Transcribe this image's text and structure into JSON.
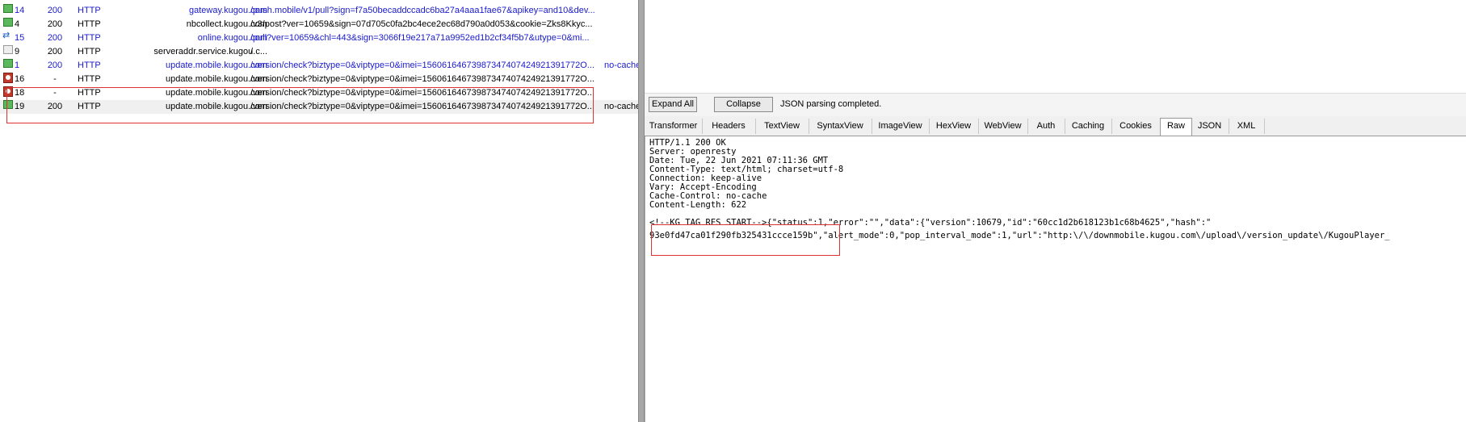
{
  "sessions": [
    {
      "icon": "green-arrow",
      "num": "14",
      "result": "200",
      "protocol": "HTTP",
      "host": "gateway.kugou.com",
      "url": "/push.mobile/v1/pull?sign=f7a50becaddccadc6ba27a4aaa1fae67&apikey=and10&dev...",
      "cache": "",
      "color": "blue",
      "selected": false
    },
    {
      "icon": "green-arrow",
      "num": "4",
      "result": "200",
      "protocol": "HTTP",
      "host": "nbcollect.kugou.com",
      "url": "/v3/post?ver=10659&sign=07d705c0fa2bc4ece2ec68d790a0d053&cookie=Zks8Kkyc...",
      "cache": "",
      "color": "black",
      "selected": false
    },
    {
      "icon": "arrows",
      "num": "15",
      "result": "200",
      "protocol": "HTTP",
      "host": "online.kugou.com",
      "url": "/pull?ver=10659&chl=443&sign=3066f19e217a71a9952ed1b2cf34f5b7&utype=0&mi...",
      "cache": "",
      "color": "blue",
      "selected": false
    },
    {
      "icon": "grey",
      "num": "9",
      "result": "200",
      "protocol": "HTTP",
      "host": "serveraddr.service.kugou.c...",
      "url": "/",
      "cache": "",
      "color": "black",
      "selected": false
    },
    {
      "icon": "green-arrow",
      "num": "1",
      "result": "200",
      "protocol": "HTTP",
      "host": "update.mobile.kugou.com",
      "url": "/version/check?biztype=0&viptype=0&imei=15606164673987347407424921391772O...",
      "cache": "no-cache",
      "color": "blue",
      "selected": false
    },
    {
      "icon": "red-stop",
      "num": "16",
      "result": "-",
      "protocol": "HTTP",
      "host": "update.mobile.kugou.com",
      "url": "/version/check?biztype=0&viptype=0&imei=15606164673987347407424921391772O...",
      "cache": "",
      "color": "black",
      "selected": false
    },
    {
      "icon": "red-stop",
      "num": "18",
      "result": "-",
      "protocol": "HTTP",
      "host": "update.mobile.kugou.com",
      "url": "/version/check?biztype=0&viptype=0&imei=15606164673987347407424921391772O...",
      "cache": "",
      "color": "black",
      "selected": false
    },
    {
      "icon": "green-arrow",
      "num": "19",
      "result": "200",
      "protocol": "HTTP",
      "host": "update.mobile.kugou.com",
      "url": "/version/check?biztype=0&viptype=0&imei=15606164673987347407424921391772O...",
      "cache": "no-cache",
      "color": "black",
      "selected": true
    }
  ],
  "json_toolbar": {
    "expand_all": "Expand All",
    "collapse": "Collapse",
    "status": "JSON parsing completed."
  },
  "response_tabs": [
    "Transformer",
    "Headers",
    "TextView",
    "SyntaxView",
    "ImageView",
    "HexView",
    "WebView",
    "Auth",
    "Caching",
    "Cookies",
    "Raw",
    "JSON",
    "XML"
  ],
  "active_tab": "Raw",
  "raw": {
    "headers": "HTTP/1.1 200 OK\nServer: openresty\nDate: Tue, 22 Jun 2021 07:11:36 GMT\nContent-Type: text/html; charset=utf-8\nConnection: keep-alive\nVary: Accept-Encoding\nCache-Control: no-cache\nContent-Length: 622",
    "body_line1": "<!--KG TAG RES START-->{\"status\":1,\"error\":\"\",\"data\":{\"version\":10679,\"id\":\"60cc1d2b618123b1c68b4625\",\"hash\":\"",
    "body_line2": "93e0fd47ca01f290fb325431ccce159b\",\"alert_mode\":0,\"pop_interval_mode\":1,\"url\":\"http:\\/\\/downmobile.kugou.com\\/upload\\/version_update\\/KugouPlayer_"
  }
}
